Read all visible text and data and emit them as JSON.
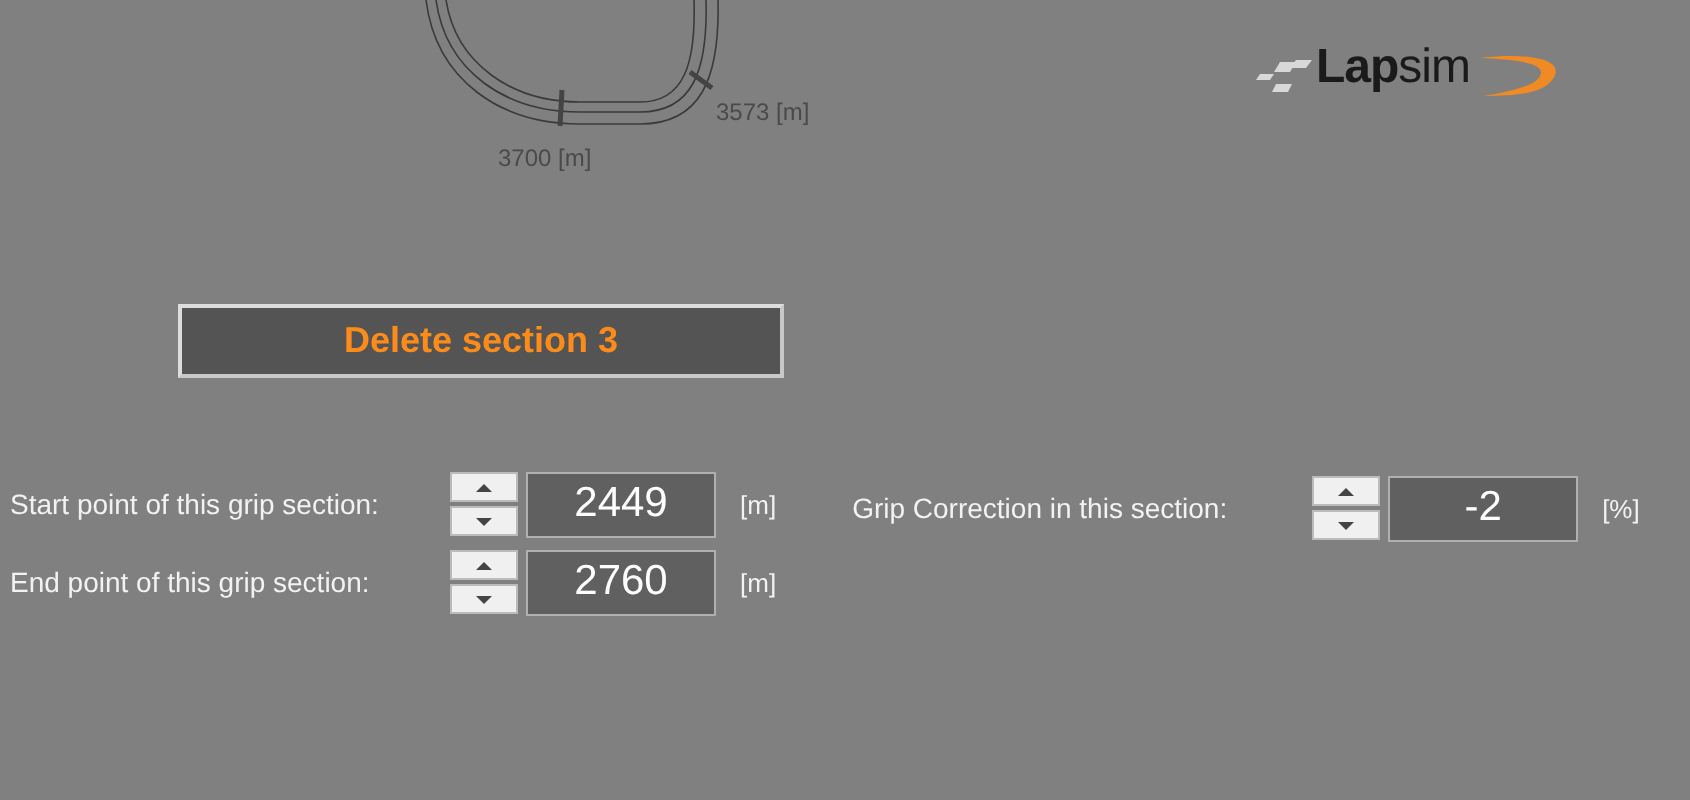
{
  "track": {
    "markers": [
      {
        "label": "3700 [m]"
      },
      {
        "label": "3573 [m]"
      }
    ]
  },
  "logo": {
    "text": "**Lap**sim"
  },
  "delete_button": {
    "label": "Delete section 3"
  },
  "fields": [
    {
      "label": "Start point of this grip section:",
      "value": "2449",
      "unit": "[m]"
    },
    {
      "label": "End point of this grip section:",
      "value": "2760",
      "unit": "[m]"
    }
  ],
  "grip_correction": {
    "label": "Grip Correction in this section:",
    "value": "-2",
    "unit": "[%]"
  }
}
